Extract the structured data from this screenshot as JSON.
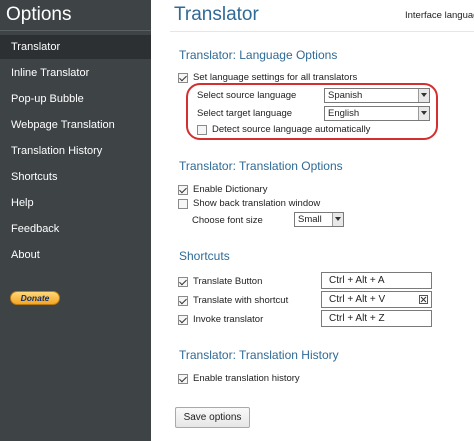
{
  "sidebar": {
    "title": "Options",
    "items": [
      {
        "label": "Translator"
      },
      {
        "label": "Inline Translator"
      },
      {
        "label": "Pop-up Bubble"
      },
      {
        "label": "Webpage Translation"
      },
      {
        "label": "Translation History"
      },
      {
        "label": "Shortcuts"
      },
      {
        "label": "Help"
      },
      {
        "label": "Feedback"
      },
      {
        "label": "About"
      }
    ],
    "donate_label": "Donate"
  },
  "header": {
    "title": "Translator",
    "interface_language_label": "Interface language"
  },
  "language_options": {
    "title": "Translator: Language Options",
    "set_all_label": "Set language settings for all translators",
    "source_label": "Select source language",
    "source_value": "Spanish",
    "target_label": "Select target language",
    "target_value": "English",
    "detect_label": "Detect source language automatically"
  },
  "translation_options": {
    "title": "Translator: Translation Options",
    "dictionary_label": "Enable Dictionary",
    "back_translation_label": "Show back translation window",
    "font_size_label": "Choose font size",
    "font_size_value": "Small"
  },
  "shortcuts": {
    "title": "Shortcuts",
    "items": [
      {
        "label": "Translate Button",
        "keys": "Ctrl + Alt + A"
      },
      {
        "label": "Translate with shortcut",
        "keys": "Ctrl + Alt + V"
      },
      {
        "label": "Invoke translator",
        "keys": "Ctrl + Alt + Z"
      }
    ]
  },
  "history": {
    "title": "Translator: Translation History",
    "enable_label": "Enable translation history"
  },
  "footer": {
    "save_label": "Save options"
  },
  "colors": {
    "sidebar_bg": "#3e4346",
    "accent": "#2f6a96",
    "highlight": "#d32f2f"
  }
}
